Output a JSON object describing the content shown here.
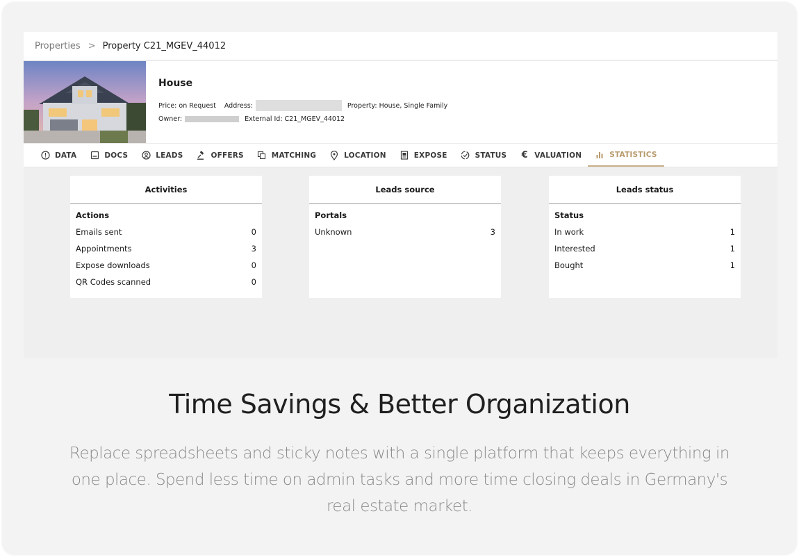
{
  "breadcrumb": {
    "root": "Properties",
    "separator": ">",
    "current": "Property C21_MGEV_44012"
  },
  "property": {
    "title": "House",
    "price": "Price: on Request",
    "address_label": "Address:",
    "property_type": "Property: House, Single Family",
    "owner_label": "Owner:",
    "external_id": "External Id: C21_MGEV_44012"
  },
  "tabs": [
    {
      "label": "DATA",
      "icon": "info-circle-icon"
    },
    {
      "label": "DOCS",
      "icon": "document-icon"
    },
    {
      "label": "LEADS",
      "icon": "leads-icon"
    },
    {
      "label": "OFFERS",
      "icon": "gavel-icon"
    },
    {
      "label": "MATCHING",
      "icon": "copy-icon"
    },
    {
      "label": "LOCATION",
      "icon": "location-pin-icon"
    },
    {
      "label": "EXPOSE",
      "icon": "expose-icon"
    },
    {
      "label": "STATUS",
      "icon": "status-icon"
    },
    {
      "label": "VALUATION",
      "icon": "euro-icon"
    },
    {
      "label": "STATISTICS",
      "icon": "bar-chart-icon",
      "active": true
    }
  ],
  "cards": {
    "activities": {
      "title": "Activities",
      "subtitle": "Actions",
      "rows": [
        {
          "label": "Emails sent",
          "value": "0"
        },
        {
          "label": "Appointments",
          "value": "3"
        },
        {
          "label": "Expose downloads",
          "value": "0"
        },
        {
          "label": "QR Codes scanned",
          "value": "0"
        }
      ]
    },
    "leads_source": {
      "title": "Leads source",
      "subtitle": "Portals",
      "rows": [
        {
          "label": "Unknown",
          "value": "3"
        }
      ]
    },
    "leads_status": {
      "title": "Leads status",
      "subtitle": "Status",
      "rows": [
        {
          "label": "In work",
          "value": "1"
        },
        {
          "label": "Interested",
          "value": "1"
        },
        {
          "label": "Bought",
          "value": "1"
        }
      ]
    }
  },
  "marketing": {
    "headline": "Time Savings & Better Organization",
    "body": "Replace spreadsheets and sticky notes with a single platform that keeps everything in one place. Spend less time on admin tasks and more time closing deals in Germany's real estate market."
  },
  "colors": {
    "active_tab": "#b89a6c",
    "background": "#f3f3f3"
  }
}
